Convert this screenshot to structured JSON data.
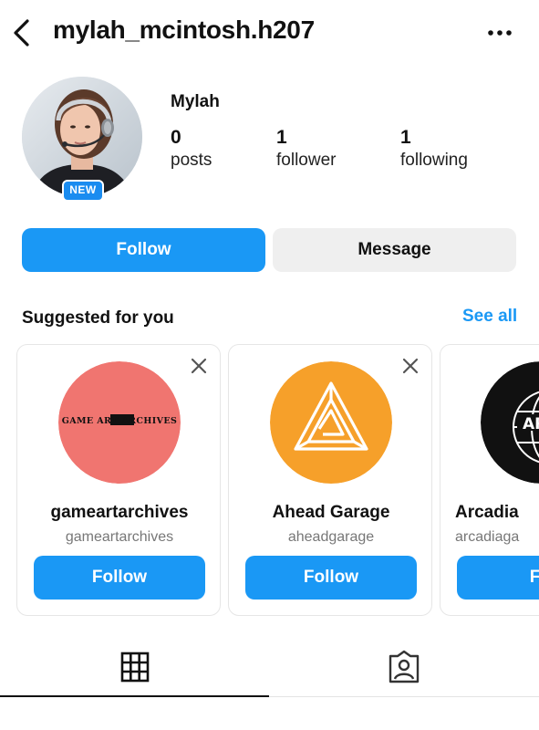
{
  "header": {
    "username": "mylah_mcintosh.h207",
    "back_icon": "chevron-left-icon",
    "more_icon": "more-horizontal-icon"
  },
  "profile": {
    "display_name": "Mylah",
    "badge": "NEW",
    "stats": [
      {
        "value": "0",
        "label": "posts"
      },
      {
        "value": "1",
        "label": "follower"
      },
      {
        "value": "1",
        "label": "following"
      }
    ]
  },
  "actions": {
    "follow_label": "Follow",
    "message_label": "Message"
  },
  "suggested": {
    "title": "Suggested for you",
    "see_all": "See all",
    "cards": [
      {
        "name": "gameartarchives",
        "handle": "gameartarchives",
        "follow_label": "Follow",
        "logo_text": "GAME ART ARCHIVES",
        "logo_color": "#f07570"
      },
      {
        "name": "Ahead Garage",
        "handle": "aheadgarage",
        "follow_label": "Follow",
        "logo_color": "#f6a02a"
      },
      {
        "name": "Arcadia",
        "handle": "arcadiaga",
        "follow_label": "Fol",
        "logo_text": "ARC",
        "logo_text_2": "GA",
        "logo_color": "#111111"
      }
    ]
  },
  "tabs": [
    {
      "icon": "grid-icon",
      "selected": true
    },
    {
      "icon": "tagged-person-icon",
      "selected": false
    }
  ],
  "colors": {
    "accent": "#1a98f5",
    "badge": "#1a8cf0",
    "secondary_button": "#efefef"
  }
}
